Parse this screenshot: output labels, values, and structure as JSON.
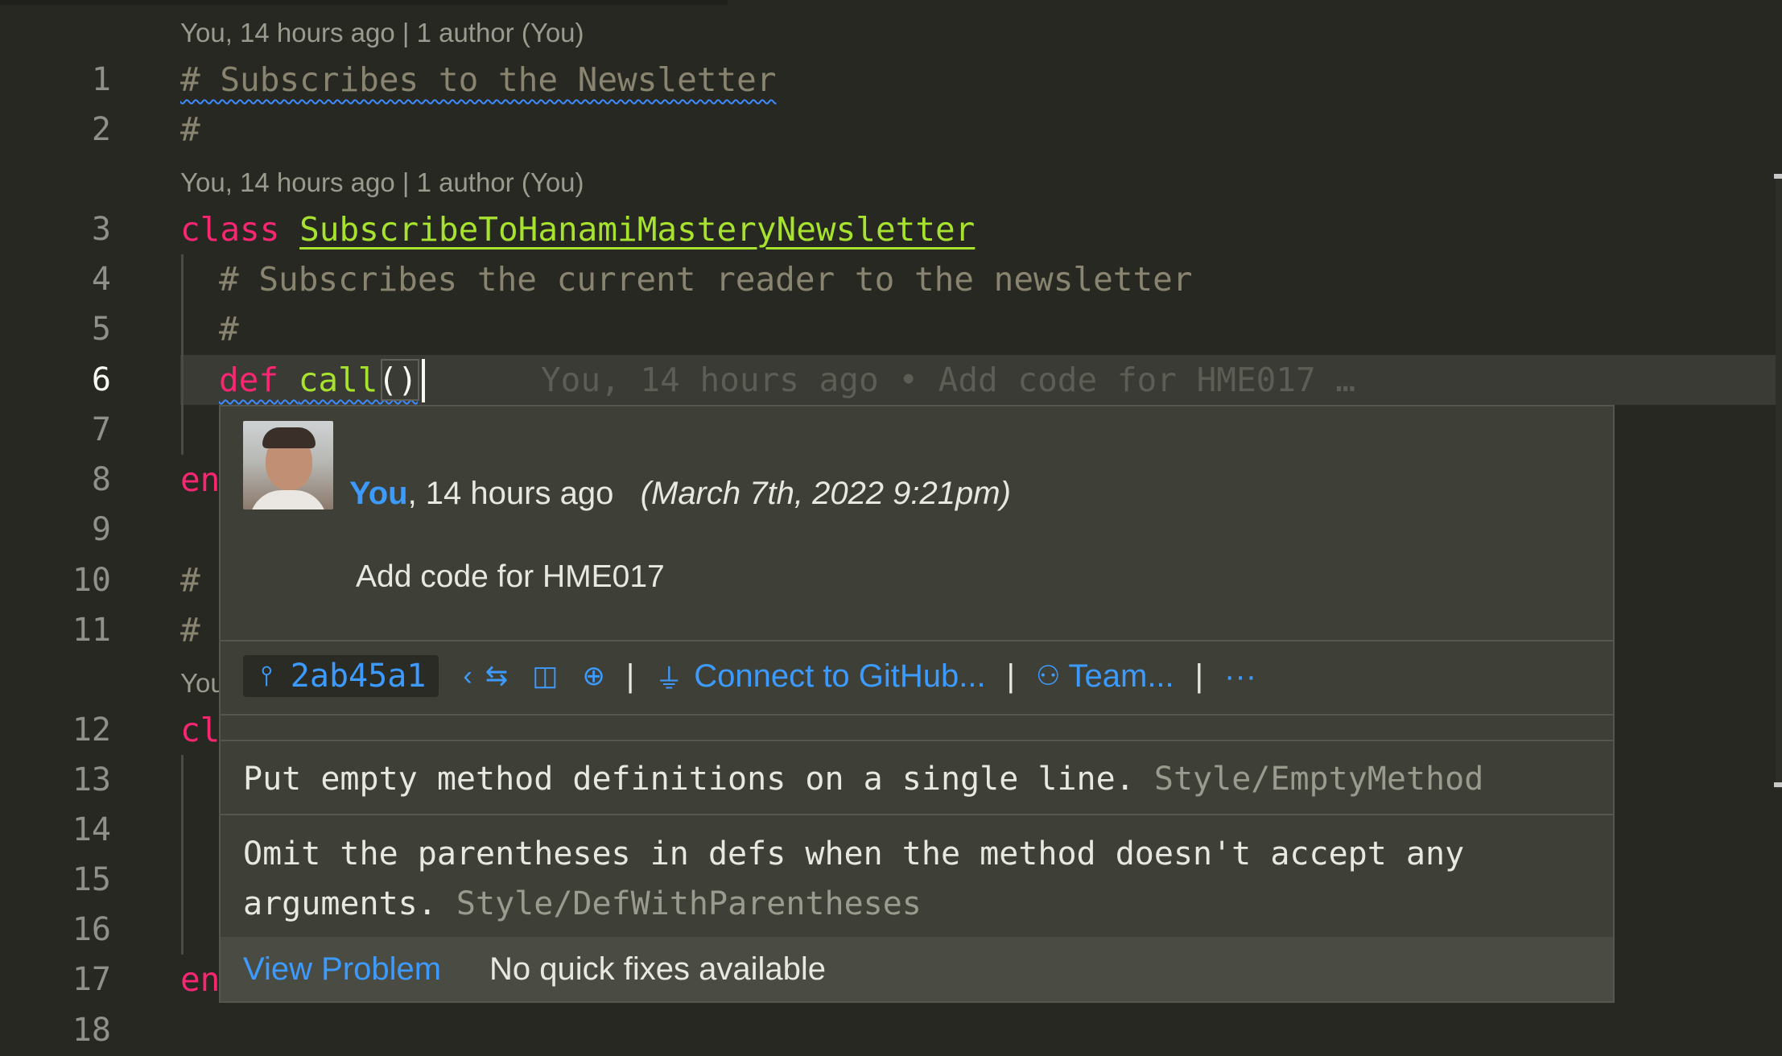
{
  "codelens": {
    "top": "You, 14 hours ago | 1 author (You)",
    "mid": "You, 14 hours ago | 1 author (You)",
    "lower": "You"
  },
  "line_numbers": [
    "1",
    "2",
    "3",
    "4",
    "5",
    "6",
    "7",
    "8",
    "9",
    "10",
    "11",
    "12",
    "13",
    "14",
    "15",
    "16",
    "17",
    "18"
  ],
  "code": {
    "l1": "# Subscribes to the Newsletter",
    "l2": "#",
    "l3_kw": "class",
    "l3_name": "SubscribeToHanamiMasteryNewsletter",
    "l4": "# Subscribes the current reader to the newsletter",
    "l5": "#",
    "l6_kw": "def",
    "l6_name": "call",
    "l6_parens": "()",
    "l8": "en",
    "l10": "#",
    "l11": "#",
    "l12": "cl",
    "l17": "en"
  },
  "ghost_blame": "You, 14 hours ago • Add code for HME017 …",
  "hover": {
    "author": "You",
    "relative_time": ", 14 hours ago",
    "date": "(March 7th, 2022 9:21pm)",
    "message": "Add code for HME017",
    "sha": "2ab45a1",
    "connect_label": "Connect to GitHub...",
    "team_label": "Team...",
    "more_label": "···",
    "problems": [
      {
        "text": "Put empty method definitions on a single line.",
        "code": "Style/EmptyMethod"
      },
      {
        "text_line1": "Omit the parentheses in defs when the method doesn't accept any",
        "text_line2": "arguments.",
        "code": "Style/DefWithParentheses"
      }
    ],
    "view_problem": "View Problem",
    "no_fixes": "No quick fixes available"
  },
  "icons": [
    "commit-icon",
    "chevron-left-icon",
    "compare-icon",
    "toggle-panel-icon",
    "globe-icon",
    "plug-icon",
    "team-icon"
  ],
  "colors": {
    "background": "#272822",
    "keyword": "#f92672",
    "class_name": "#a6e22e",
    "comment": "#88846f",
    "link": "#3d9bff"
  }
}
